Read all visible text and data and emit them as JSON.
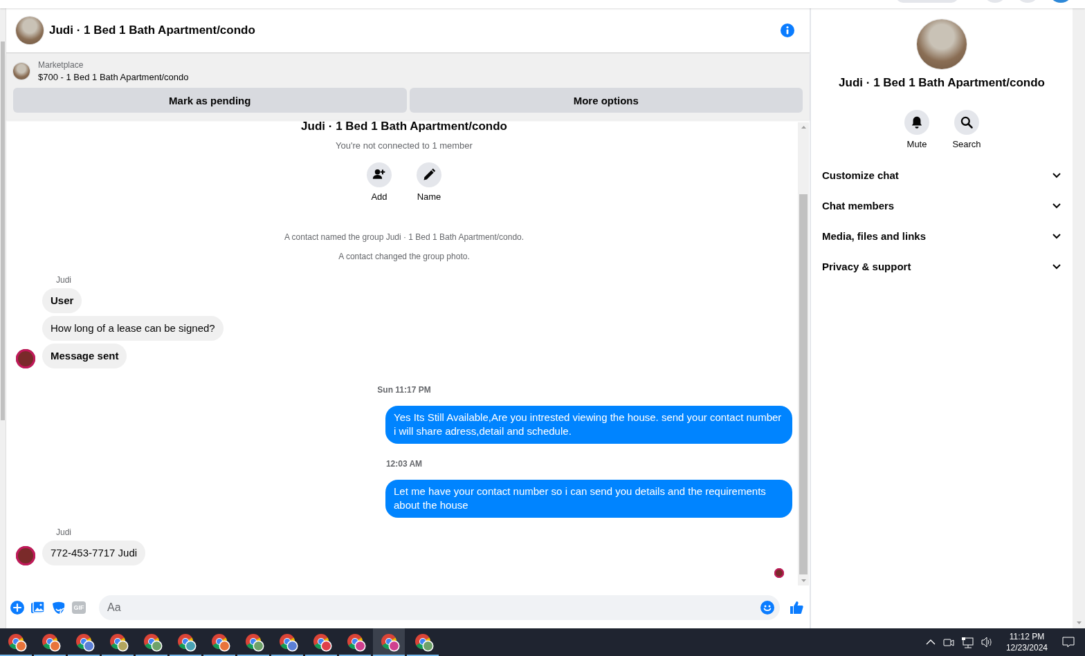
{
  "header": {
    "title": "Judi · 1 Bed 1 Bath Apartment/condo"
  },
  "listing": {
    "label": "Marketplace",
    "title": "$700 - 1 Bed 1 Bath Apartment/condo",
    "buttons": [
      "Mark as pending",
      "More options"
    ]
  },
  "thread": {
    "title": "Judi · 1 Bed 1 Bath Apartment/condo",
    "subtitle": "You're not connected to 1 member",
    "actions": [
      {
        "label": "Add",
        "kind": "add"
      },
      {
        "label": "Name",
        "kind": "name"
      }
    ]
  },
  "messages": [
    {
      "kind": "system",
      "text": "A contact named the group Judi · 1 Bed 1 Bath Apartment/condo."
    },
    {
      "kind": "system",
      "text": "A contact changed the group photo."
    },
    {
      "kind": "sender",
      "text": "Judi"
    },
    {
      "kind": "incoming",
      "text": "User",
      "bold": true,
      "avatar": false
    },
    {
      "kind": "incoming",
      "text": "How long of a lease can be signed?",
      "bold": false,
      "avatar": false
    },
    {
      "kind": "incoming",
      "text": "Message sent",
      "bold": true,
      "avatar": true
    },
    {
      "kind": "timestamp",
      "text": "Sun 11:17 PM"
    },
    {
      "kind": "outgoing",
      "text": "Yes Its Still Available,Are you intrested viewing the house. send your contact number i will share adress,detail and schedule."
    },
    {
      "kind": "timestamp",
      "text": "12:03 AM"
    },
    {
      "kind": "outgoing",
      "text": "Let me have your contact number so i can send you details and the requirements about the house"
    },
    {
      "kind": "sender",
      "text": "Judi"
    },
    {
      "kind": "incoming",
      "text": "772-453-7717 Judi",
      "bold": false,
      "avatar": true
    },
    {
      "kind": "receipt"
    }
  ],
  "composer": {
    "gif_label": "GIF",
    "placeholder": "Aa"
  },
  "side": {
    "title": "Judi · 1 Bed 1 Bath Apartment/condo",
    "actions": [
      {
        "label": "Mute",
        "kind": "mute"
      },
      {
        "label": "Search",
        "kind": "search"
      }
    ],
    "sections": [
      {
        "label": "Customize chat",
        "expanded": false
      },
      {
        "label": "Chat members",
        "expanded": false
      },
      {
        "label": "Media, files and links",
        "expanded": false
      },
      {
        "label": "Privacy & support",
        "expanded": false
      }
    ]
  },
  "taskbar": {
    "apps": [
      {
        "selected": false,
        "color": "#e8743b"
      },
      {
        "selected": false,
        "color": "#e8743b"
      },
      {
        "selected": false,
        "color": "#5b7fd6"
      },
      {
        "selected": false,
        "color": "#b3a65e"
      },
      {
        "selected": false,
        "color": "#6ea26a"
      },
      {
        "selected": false,
        "color": "#4aa3b5"
      },
      {
        "selected": false,
        "color": "#e8743b"
      },
      {
        "selected": false,
        "color": "#6ea26a"
      },
      {
        "selected": false,
        "color": "#5b7fd6"
      },
      {
        "selected": false,
        "color": "#e0404a"
      },
      {
        "selected": false,
        "color": "#d0408f"
      },
      {
        "selected": true,
        "color": "#d0408f"
      },
      {
        "selected": false,
        "color": "#6ea26a"
      }
    ],
    "time": "11:12 PM",
    "date": "12/23/2024"
  }
}
